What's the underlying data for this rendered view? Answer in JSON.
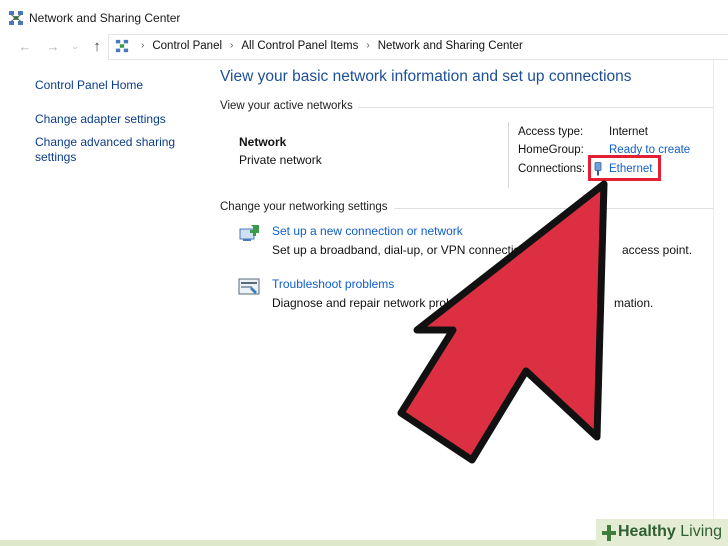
{
  "window": {
    "title": "Network and Sharing Center"
  },
  "breadcrumb": [
    "Control Panel",
    "All Control Panel Items",
    "Network and Sharing Center"
  ],
  "sidebar": {
    "items": [
      {
        "label": "Control Panel Home"
      },
      {
        "label": "Change adapter settings"
      },
      {
        "label": "Change advanced sharing settings"
      }
    ]
  },
  "main": {
    "title": "View your basic network information and set up connections",
    "active_networks": {
      "heading": "View your active networks",
      "network_name": "Network",
      "network_type": "Private network",
      "access_type_label": "Access type:",
      "access_type_value": "Internet",
      "homegroup_label": "HomeGroup:",
      "homegroup_value": "Ready to create",
      "connections_label": "Connections:",
      "connections_value": "Ethernet"
    },
    "settings": {
      "heading": "Change your networking settings",
      "tasks": [
        {
          "label": "Set up a new connection or network",
          "description": "Set up a broadband, dial-up, or VPN connection; o",
          "description_tail": "access point.",
          "icon": "network-setup-icon"
        },
        {
          "label": "Troubleshoot problems",
          "description": "Diagnose and repair network proble",
          "description_tail": "mation.",
          "icon": "troubleshoot-icon"
        }
      ]
    }
  },
  "overlay": {
    "arrow_color": "#dc2f42",
    "highlight_color": "#e21f33"
  },
  "watermark": {
    "brand": "Healthy",
    "brand_light": "Living"
  }
}
